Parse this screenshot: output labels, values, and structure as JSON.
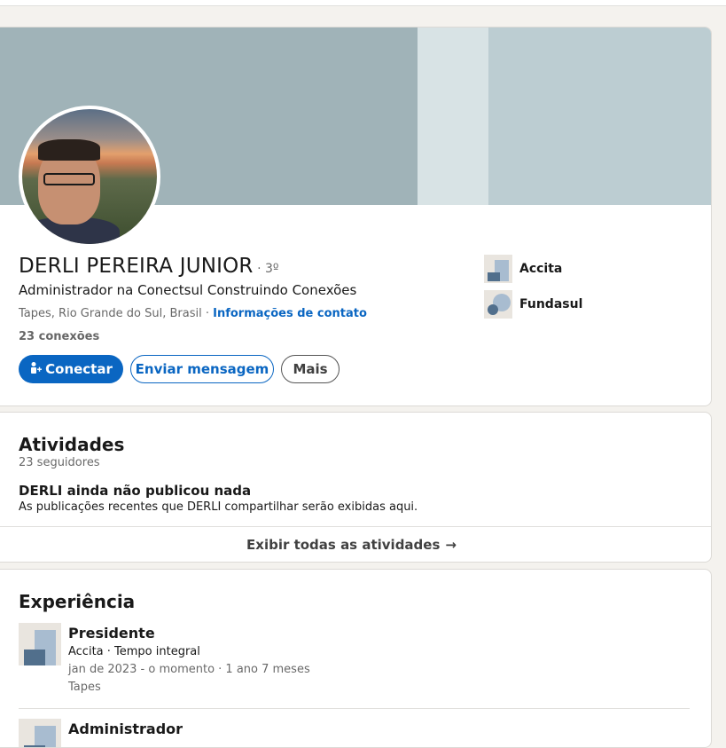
{
  "profile": {
    "name": "DERLI PEREIRA JUNIOR",
    "degree": " · 3º",
    "headline": "Administrador na Conectsul Construindo Conexões",
    "location": "Tapes, Rio Grande do Sul, Brasil · ",
    "contact_link": "Informações de contato",
    "connections": "23 conexões",
    "buttons": {
      "connect": "Conectar",
      "message": "Enviar mensagem",
      "more": "Mais"
    },
    "organizations": [
      {
        "name": "Accita",
        "icon": "accita-logo-icon"
      },
      {
        "name": "Fundasul",
        "icon": "fundasul-logo-icon"
      }
    ]
  },
  "activity": {
    "title": "Atividades",
    "followers": "23 seguidores",
    "empty_title": "DERLI ainda não publicou nada",
    "empty_desc": "As publicações recentes que DERLI compartilhar serão exibidas aqui.",
    "show_all": "Exibir todas as atividades",
    "arrow": "→"
  },
  "experience": {
    "title": "Experiência",
    "items": [
      {
        "title": "Presidente",
        "company": "Accita · Tempo integral",
        "dates": "jan de 2023 - o momento · 1 ano 7 meses",
        "location": "Tapes"
      },
      {
        "title": "Administrador"
      }
    ]
  },
  "colors": {
    "primary": "#0a66c2",
    "background": "#f4f2ee",
    "banner": "#bccdd2",
    "banner_shape": "#a0b3b8"
  }
}
